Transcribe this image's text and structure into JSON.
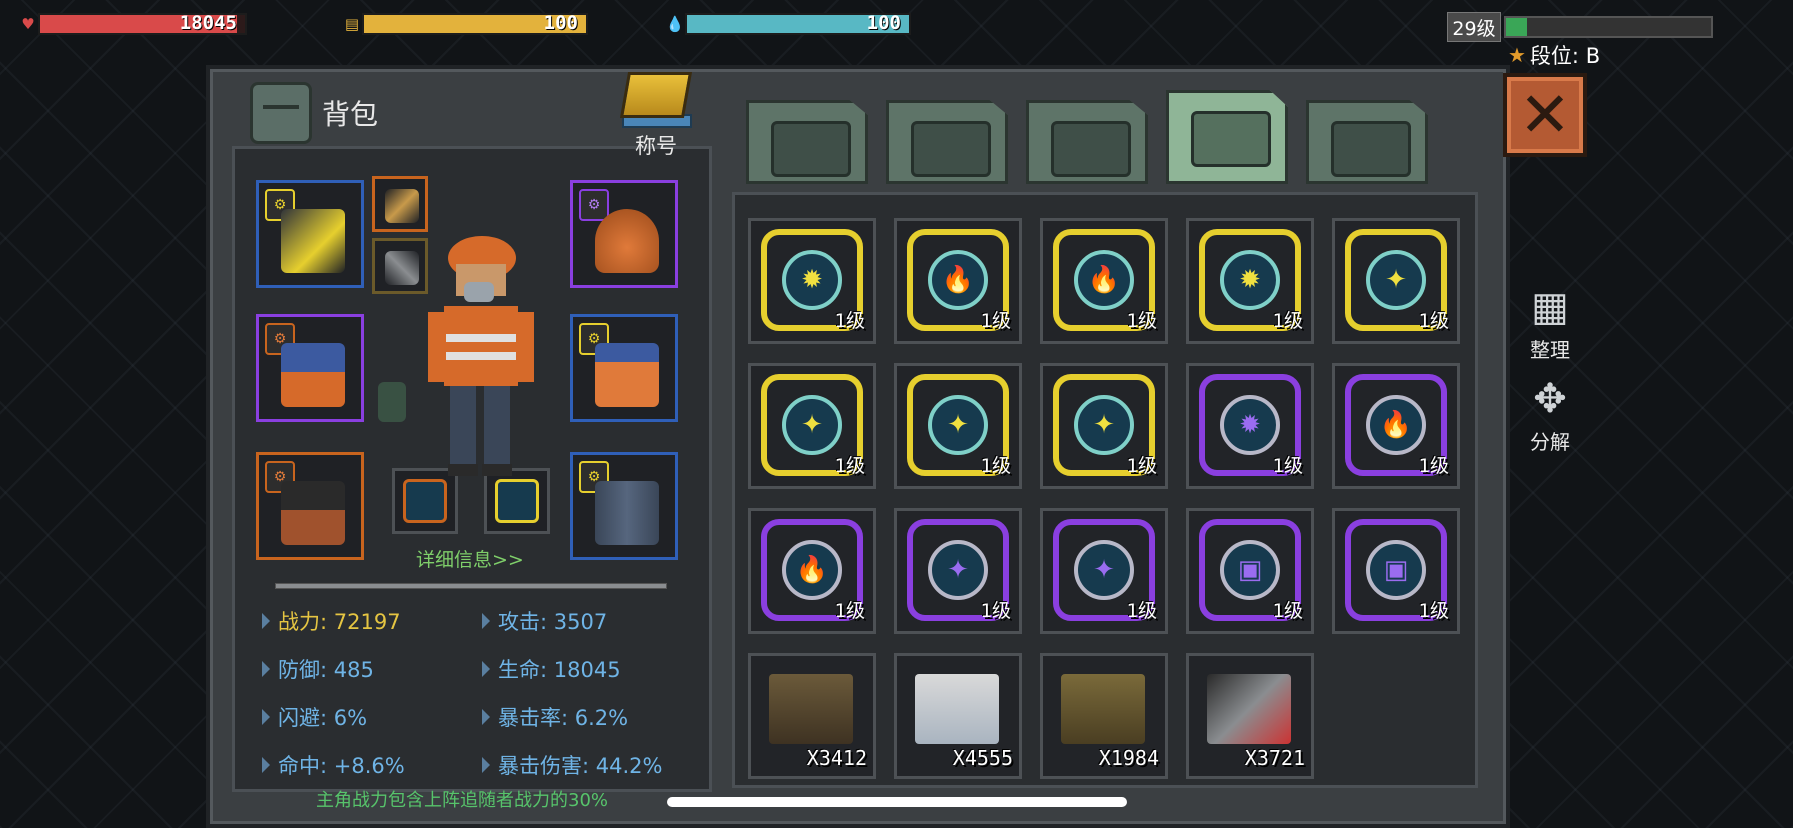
{
  "hud": {
    "hp": {
      "value": "18045",
      "fill": 0.96,
      "color": "#d94a4a"
    },
    "energy": {
      "value": "100",
      "fill": 1.0,
      "color": "#e3b23c"
    },
    "water": {
      "value": "100",
      "fill": 1.0,
      "color": "#58b8c4"
    },
    "level": "29级",
    "xp_fill": 0.1,
    "rank": "段位: B"
  },
  "backpack": {
    "title": "背包",
    "title_badge_label": "称号",
    "detail_link": "详细信息>>",
    "stats": [
      {
        "label": "战力: 72197",
        "highlight": true
      },
      {
        "label": "攻击: 3507",
        "highlight": false
      },
      {
        "label": "防御: 485",
        "highlight": false
      },
      {
        "label": "生命: 18045",
        "highlight": false
      },
      {
        "label": "闪避: 6%",
        "highlight": false
      },
      {
        "label": "暴击率: 6.2%",
        "highlight": false
      },
      {
        "label": "命中: +8.6%",
        "highlight": false
      },
      {
        "label": "暴击伤害: 44.2%",
        "highlight": false
      }
    ],
    "footer_note": "主角战力包含上阵追随者战力的30%"
  },
  "tabs": [
    {
      "name": "backpack",
      "icon": "backpack-icon",
      "active": false
    },
    {
      "name": "medkit",
      "icon": "medkit-icon",
      "active": false
    },
    {
      "name": "materials",
      "icon": "materials-icon",
      "active": false
    },
    {
      "name": "weapons",
      "icon": "pistol-icon",
      "active": true
    },
    {
      "name": "tools",
      "icon": "wrench-icon",
      "active": false
    }
  ],
  "grid": {
    "chips": [
      {
        "level": "1级",
        "tier": "gold",
        "symbol": "✹"
      },
      {
        "level": "1级",
        "tier": "gold",
        "symbol": "🔥"
      },
      {
        "level": "1级",
        "tier": "gold",
        "symbol": "🔥"
      },
      {
        "level": "1级",
        "tier": "gold",
        "symbol": "✹"
      },
      {
        "level": "1级",
        "tier": "gold",
        "symbol": "✦"
      },
      {
        "level": "1级",
        "tier": "gold",
        "symbol": "✦"
      },
      {
        "level": "1级",
        "tier": "gold",
        "symbol": "✦"
      },
      {
        "level": "1级",
        "tier": "gold",
        "symbol": "✦"
      },
      {
        "level": "1级",
        "tier": "purple",
        "symbol": "✹"
      },
      {
        "level": "1级",
        "tier": "purple",
        "symbol": "🔥"
      },
      {
        "level": "1级",
        "tier": "purple",
        "symbol": "🔥"
      },
      {
        "level": "1级",
        "tier": "purple",
        "symbol": "✦"
      },
      {
        "level": "1级",
        "tier": "purple",
        "symbol": "✦"
      },
      {
        "level": "1级",
        "tier": "purple",
        "symbol": "▣"
      },
      {
        "level": "1级",
        "tier": "purple",
        "symbol": "▣"
      }
    ],
    "ammo": [
      {
        "qty": "X3412",
        "icon": "rifle-ammo-icon"
      },
      {
        "qty": "X4555",
        "icon": "pistol-ammo-icon"
      },
      {
        "qty": "X1984",
        "icon": "shotgun-ammo-icon"
      },
      {
        "qty": "X3721",
        "icon": "arrow-quiver-icon"
      }
    ]
  },
  "side_actions": {
    "sort": "整理",
    "disassemble": "分解"
  },
  "colors": {
    "gold": "#e6cf2e",
    "purple": "#8a3fe0",
    "blue": "#2f5fb8",
    "orange": "#c8641e"
  }
}
